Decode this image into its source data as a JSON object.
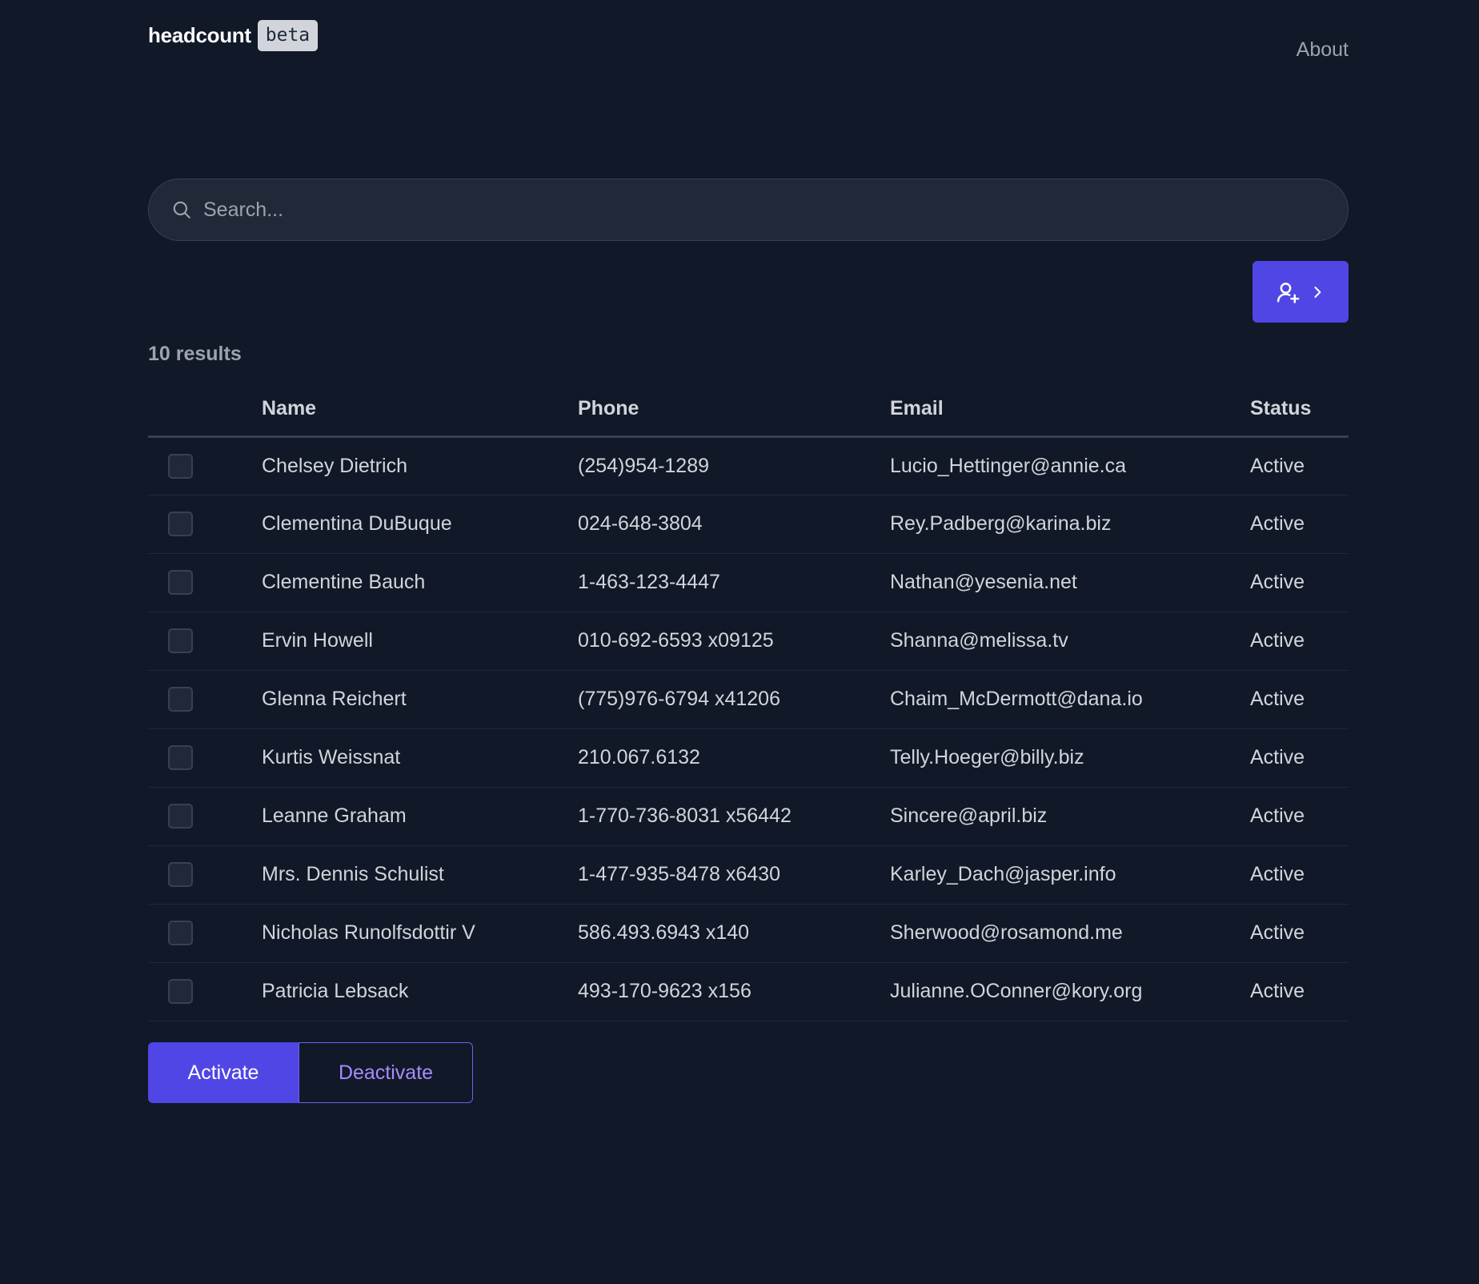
{
  "header": {
    "brand_name": "headcount",
    "brand_badge": "beta",
    "nav_about": "About"
  },
  "search": {
    "placeholder": "Search...",
    "value": "",
    "icon": "search-icon"
  },
  "add_user_button": {
    "icons": [
      "user-plus-icon",
      "chevron-right-icon"
    ],
    "color": "#4f46e5"
  },
  "results": {
    "count_label": "10 results"
  },
  "table": {
    "columns": [
      "Name",
      "Phone",
      "Email",
      "Status"
    ],
    "rows": [
      {
        "name": "Chelsey Dietrich",
        "phone": "(254)954-1289",
        "email": "Lucio_Hettinger@annie.ca",
        "status": "Active"
      },
      {
        "name": "Clementina DuBuque",
        "phone": "024-648-3804",
        "email": "Rey.Padberg@karina.biz",
        "status": "Active"
      },
      {
        "name": "Clementine Bauch",
        "phone": "1-463-123-4447",
        "email": "Nathan@yesenia.net",
        "status": "Active"
      },
      {
        "name": "Ervin Howell",
        "phone": "010-692-6593 x09125",
        "email": "Shanna@melissa.tv",
        "status": "Active"
      },
      {
        "name": "Glenna Reichert",
        "phone": "(775)976-6794 x41206",
        "email": "Chaim_McDermott@dana.io",
        "status": "Active"
      },
      {
        "name": "Kurtis Weissnat",
        "phone": "210.067.6132",
        "email": "Telly.Hoeger@billy.biz",
        "status": "Active"
      },
      {
        "name": "Leanne Graham",
        "phone": "1-770-736-8031 x56442",
        "email": "Sincere@april.biz",
        "status": "Active"
      },
      {
        "name": "Mrs. Dennis Schulist",
        "phone": "1-477-935-8478 x6430",
        "email": "Karley_Dach@jasper.info",
        "status": "Active"
      },
      {
        "name": "Nicholas Runolfsdottir V",
        "phone": "586.493.6943 x140",
        "email": "Sherwood@rosamond.me",
        "status": "Active"
      },
      {
        "name": "Patricia Lebsack",
        "phone": "493-170-9623 x156",
        "email": "Julianne.OConner@kory.org",
        "status": "Active"
      }
    ]
  },
  "actions": {
    "activate_label": "Activate",
    "deactivate_label": "Deactivate"
  },
  "colors": {
    "background": "#111827",
    "accent": "#4f46e5",
    "accent_text": "#a78bfa"
  }
}
